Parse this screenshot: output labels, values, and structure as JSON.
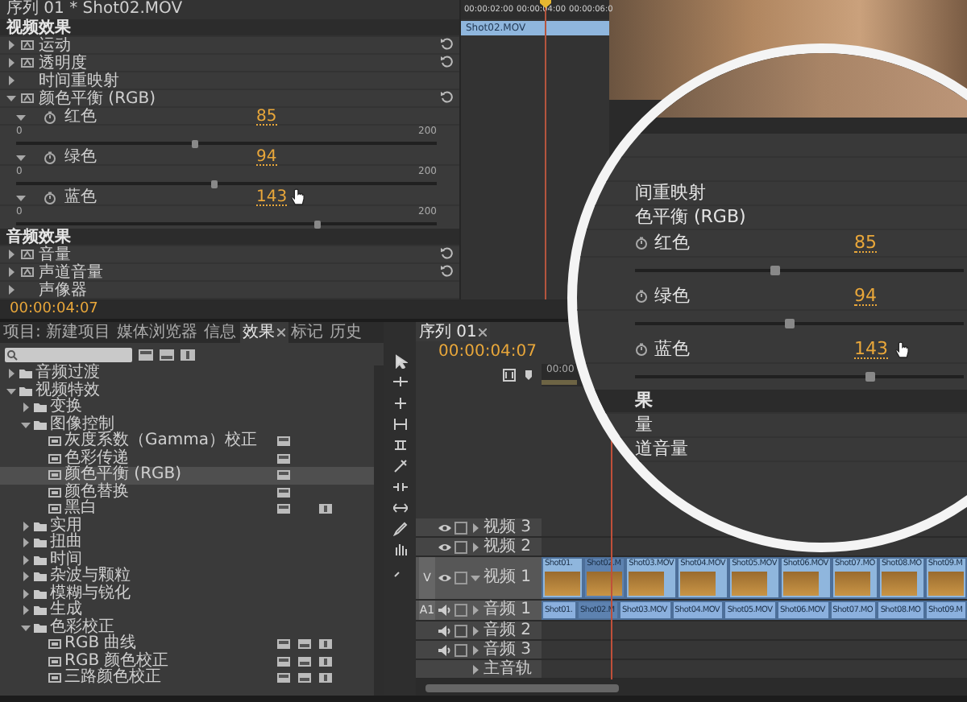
{
  "effect_controls": {
    "header": "序列 01 * Shot02.MOV",
    "ruler": [
      "00:00:02:00",
      "00:00:04:00",
      "00:00:06:0"
    ],
    "clip": "Shot02.MOV",
    "sections": [
      {
        "title": "视频效果",
        "items": [
          {
            "kind": "effect",
            "label": "运动",
            "expanded": false,
            "fx": true,
            "reset": true
          },
          {
            "kind": "effect",
            "label": "透明度",
            "expanded": false,
            "fx": true,
            "reset": true
          },
          {
            "kind": "effect",
            "label": "时间重映射",
            "expanded": false,
            "fx": false,
            "reset": false
          },
          {
            "kind": "effect",
            "label": "颜色平衡 (RGB)",
            "expanded": true,
            "fx": true,
            "reset": true
          },
          {
            "kind": "param",
            "label": "红色",
            "value": "85",
            "min": "0",
            "max": "200",
            "level": 0.425,
            "expanded": true,
            "hover": false
          },
          {
            "kind": "param",
            "label": "绿色",
            "value": "94",
            "min": "0",
            "max": "200",
            "level": 0.47,
            "expanded": true,
            "hover": false
          },
          {
            "kind": "param",
            "label": "蓝色",
            "value": "143",
            "min": "0",
            "max": "200",
            "level": 0.715,
            "expanded": true,
            "hover": true
          }
        ]
      },
      {
        "title": "音频效果",
        "items": [
          {
            "kind": "effect",
            "label": "音量",
            "expanded": false,
            "fx": true,
            "reset": true
          },
          {
            "kind": "effect",
            "label": "声道音量",
            "expanded": false,
            "fx": true,
            "reset": true
          },
          {
            "kind": "effect",
            "label": "声像器",
            "expanded": false,
            "fx": false,
            "reset": false
          }
        ]
      }
    ],
    "timecode": "00:00:04:07"
  },
  "magnifier": {
    "rows": [
      {
        "kind": "blank"
      },
      {
        "kind": "blank"
      },
      {
        "kind": "effect",
        "label": "间重映射"
      },
      {
        "kind": "effect",
        "label": "色平衡 (RGB)"
      },
      {
        "kind": "param",
        "label": "红色",
        "value": "85",
        "level": 0.425,
        "hover": false
      },
      {
        "kind": "param",
        "label": "绿色",
        "value": "94",
        "level": 0.47,
        "hover": false
      },
      {
        "kind": "param",
        "label": "蓝色",
        "value": "143",
        "level": 0.715,
        "hover": true
      },
      {
        "kind": "section",
        "label": "果"
      },
      {
        "kind": "effect",
        "label": "量"
      },
      {
        "kind": "effect",
        "label": "道音量"
      }
    ]
  },
  "effects_panel": {
    "tabs": [
      {
        "label": "项目: 新建项目",
        "selected": false
      },
      {
        "label": "媒体浏览器",
        "selected": false
      },
      {
        "label": "信息",
        "selected": false
      },
      {
        "label": "效果",
        "selected": true
      },
      {
        "label": "标记",
        "selected": false
      },
      {
        "label": "历史",
        "selected": false
      }
    ],
    "tree": [
      {
        "kind": "folder",
        "label": "音频过渡",
        "expanded": false,
        "selected": false
      },
      {
        "kind": "folder",
        "label": "视频特效",
        "expanded": true,
        "selected": false,
        "children": [
          {
            "kind": "folder",
            "label": "变换",
            "expanded": false,
            "selected": false
          },
          {
            "kind": "folder",
            "label": "图像控制",
            "expanded": true,
            "selected": false,
            "children": [
              {
                "kind": "effect",
                "label": "灰度系数（Gamma）校正",
                "selected": false,
                "accelerated": true,
                "bit32": false,
                "yuv": false
              },
              {
                "kind": "effect",
                "label": "色彩传递",
                "selected": false,
                "accelerated": true,
                "bit32": false,
                "yuv": false
              },
              {
                "kind": "effect",
                "label": "颜色平衡 (RGB)",
                "selected": true,
                "accelerated": true,
                "bit32": false,
                "yuv": false
              },
              {
                "kind": "effect",
                "label": "颜色替换",
                "selected": false,
                "accelerated": true,
                "bit32": false,
                "yuv": false
              },
              {
                "kind": "effect",
                "label": "黑白",
                "selected": false,
                "accelerated": true,
                "bit32": false,
                "yuv": true
              }
            ]
          },
          {
            "kind": "folder",
            "label": "实用",
            "expanded": false,
            "selected": false
          },
          {
            "kind": "folder",
            "label": "扭曲",
            "expanded": false,
            "selected": false
          },
          {
            "kind": "folder",
            "label": "时间",
            "expanded": false,
            "selected": false
          },
          {
            "kind": "folder",
            "label": "杂波与颗粒",
            "expanded": false,
            "selected": false
          },
          {
            "kind": "folder",
            "label": "模糊与锐化",
            "expanded": false,
            "selected": false
          },
          {
            "kind": "folder",
            "label": "生成",
            "expanded": false,
            "selected": false
          },
          {
            "kind": "folder",
            "label": "色彩校正",
            "expanded": true,
            "selected": false,
            "children": [
              {
                "kind": "effect",
                "label": "RGB 曲线",
                "selected": false,
                "accelerated": true,
                "bit32": true,
                "yuv": true
              },
              {
                "kind": "effect",
                "label": "RGB 颜色校正",
                "selected": false,
                "accelerated": true,
                "bit32": true,
                "yuv": true
              },
              {
                "kind": "effect",
                "label": "三路颜色校正",
                "selected": false,
                "accelerated": true,
                "bit32": true,
                "yuv": true
              }
            ]
          }
        ]
      }
    ]
  },
  "timeline": {
    "tab": "序列 01",
    "timecode": "00:00:04:07",
    "ruler": [
      "00:00"
    ],
    "tracks": [
      {
        "kind": "video",
        "label": "视频 3",
        "expanded": false
      },
      {
        "kind": "video",
        "label": "视频 2",
        "expanded": false
      },
      {
        "kind": "video",
        "label": "视频 1",
        "expanded": true,
        "target": "V",
        "clips": [
          {
            "label": "Shot01.",
            "selected": false
          },
          {
            "label": "Shot02.M",
            "selected": true
          },
          {
            "label": "Shot03.MOV",
            "selected": false
          },
          {
            "label": "Shot04.MOV",
            "selected": false
          },
          {
            "label": "Shot05.MOV",
            "selected": false
          },
          {
            "label": "Shot06.MOV",
            "selected": false
          },
          {
            "label": "Shot07.MO",
            "selected": false
          },
          {
            "label": "Shot08.MO",
            "selected": false
          },
          {
            "label": "Shot09.M",
            "selected": false
          }
        ]
      },
      {
        "kind": "audio",
        "label": "音频 1",
        "expanded": false,
        "target": "A1",
        "clips": [
          {
            "label": "Shot01.",
            "selected": false
          },
          {
            "label": "Shot02.M",
            "selected": true
          },
          {
            "label": "Shot03.MOV",
            "selected": false
          },
          {
            "label": "Shot04.MOV",
            "selected": false
          },
          {
            "label": "Shot05.MOV",
            "selected": false
          },
          {
            "label": "Shot06.MOV",
            "selected": false
          },
          {
            "label": "Shot07.MO",
            "selected": false
          },
          {
            "label": "Shot08.MO",
            "selected": false
          },
          {
            "label": "Shot09.M",
            "selected": false
          }
        ]
      },
      {
        "kind": "audio",
        "label": "音频 2",
        "expanded": false
      },
      {
        "kind": "audio",
        "label": "音频 3",
        "expanded": false
      },
      {
        "kind": "master",
        "label": "主音轨",
        "expanded": false
      }
    ]
  }
}
